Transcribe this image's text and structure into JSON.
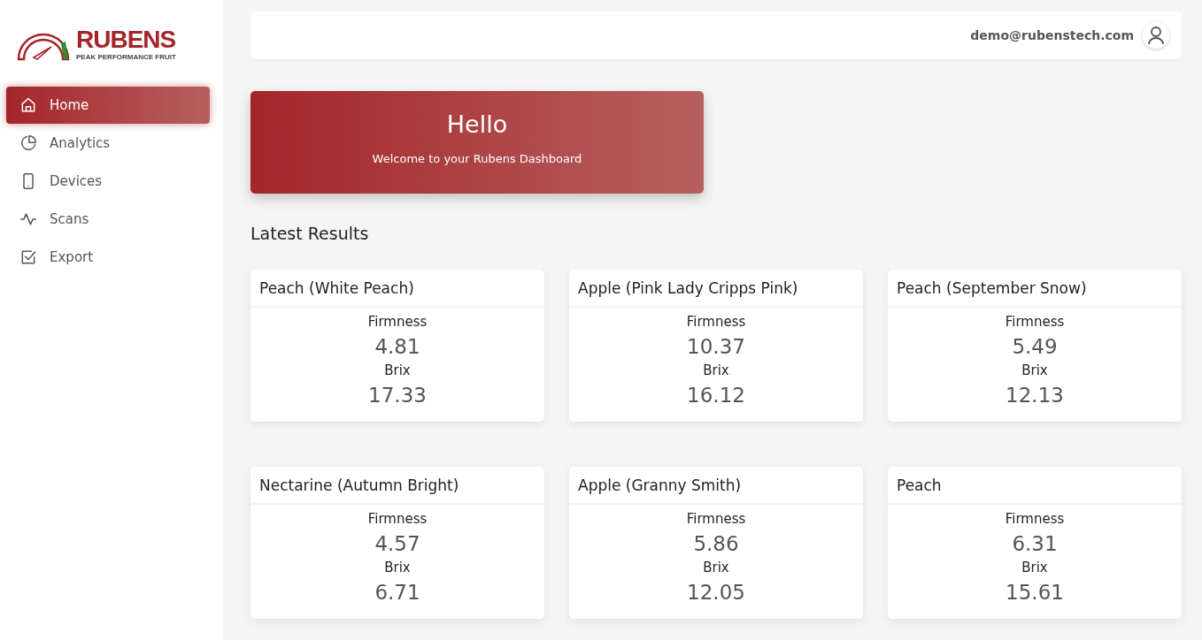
{
  "logo": {
    "name": "RUBENS",
    "tagline": "PEAK PERFORMANCE FRUIT"
  },
  "sidebar": {
    "items": [
      {
        "label": "Home",
        "selected": true
      },
      {
        "label": "Analytics",
        "selected": false
      },
      {
        "label": "Devices",
        "selected": false
      },
      {
        "label": "Scans",
        "selected": false
      },
      {
        "label": "Export",
        "selected": false
      }
    ]
  },
  "topbar": {
    "email": "demo@rubenstech.com"
  },
  "banner": {
    "title": "Hello",
    "subtitle": "Welcome to your Rubens Dashboard"
  },
  "section_title": "Latest Results",
  "results": [
    {
      "title": "Peach (White Peach)",
      "metrics": [
        {
          "label": "Firmness",
          "value": "4.81"
        },
        {
          "label": "Brix",
          "value": "17.33"
        }
      ]
    },
    {
      "title": "Apple (Pink Lady Cripps Pink)",
      "metrics": [
        {
          "label": "Firmness",
          "value": "10.37"
        },
        {
          "label": "Brix",
          "value": "16.12"
        }
      ]
    },
    {
      "title": "Peach (September Snow)",
      "metrics": [
        {
          "label": "Firmness",
          "value": "5.49"
        },
        {
          "label": "Brix",
          "value": "12.13"
        }
      ]
    },
    {
      "title": "Nectarine (Autumn Bright)",
      "metrics": [
        {
          "label": "Firmness",
          "value": "4.57"
        },
        {
          "label": "Brix",
          "value": "6.71"
        }
      ]
    },
    {
      "title": "Apple (Granny Smith)",
      "metrics": [
        {
          "label": "Firmness",
          "value": "5.86"
        },
        {
          "label": "Brix",
          "value": "12.05"
        }
      ]
    },
    {
      "title": "Peach",
      "metrics": [
        {
          "label": "Firmness",
          "value": "6.31"
        },
        {
          "label": "Brix",
          "value": "15.61"
        }
      ]
    }
  ]
}
